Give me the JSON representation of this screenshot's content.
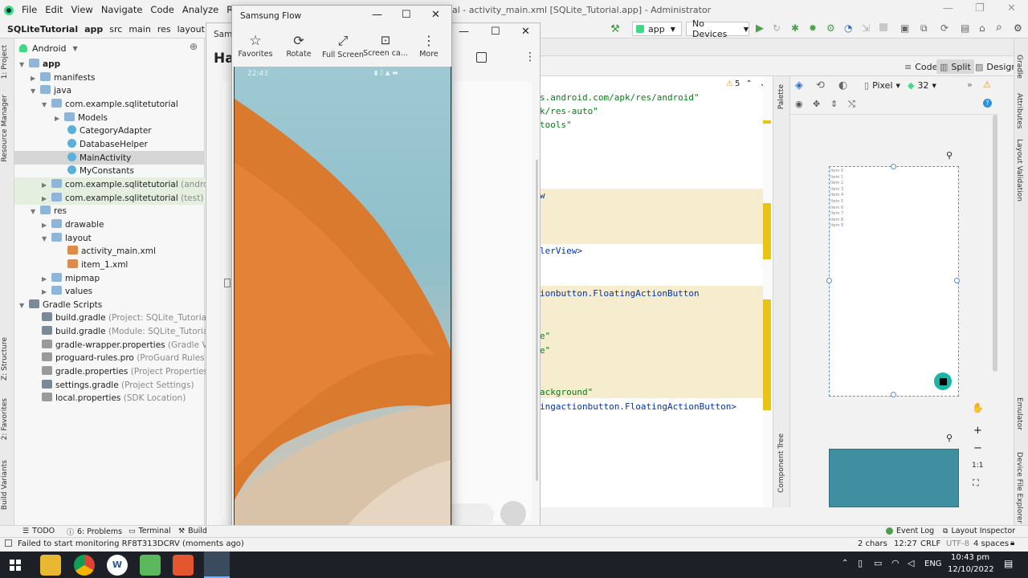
{
  "menu": {
    "items": [
      "File",
      "Edit",
      "View",
      "Navigate",
      "Code",
      "Analyze",
      "Refactor"
    ],
    "title_fragment": "al - activity_main.xml [SQLite_Tutorial.app] - Administrator"
  },
  "nav": {
    "crumbs": [
      "SQLiteTutorial",
      "app",
      "src",
      "main",
      "res",
      "layout"
    ],
    "run_config": "app",
    "device": "No Devices"
  },
  "left_tabs": {
    "project": "1: Project",
    "resource_manager": "Resource Manager",
    "structure": "Z: Structure",
    "favorites": "2: Favorites",
    "build_variants": "Build Variants"
  },
  "project_panel": {
    "view_mode": "Android",
    "tree": [
      {
        "label": "app",
        "bold": true
      },
      {
        "label": "manifests"
      },
      {
        "label": "java"
      },
      {
        "label": "com.example.sqlitetutorial"
      },
      {
        "label": "Models"
      },
      {
        "label": "CategoryAdapter"
      },
      {
        "label": "DatabaseHelper"
      },
      {
        "label": "MainActivity"
      },
      {
        "label": "MyConstants"
      },
      {
        "label": "com.example.sqlitetutorial",
        "suffix": "(androidTes"
      },
      {
        "label": "com.example.sqlitetutorial",
        "suffix": "(test)"
      },
      {
        "label": "res"
      },
      {
        "label": "drawable"
      },
      {
        "label": "layout"
      },
      {
        "label": "activity_main.xml"
      },
      {
        "label": "item_1.xml"
      },
      {
        "label": "mipmap"
      },
      {
        "label": "values"
      },
      {
        "label": "Gradle Scripts"
      },
      {
        "label": "build.gradle",
        "suffix": "(Project: SQLite_Tutorial)"
      },
      {
        "label": "build.gradle",
        "suffix": "(Module: SQLite_Tutorial.app)"
      },
      {
        "label": "gradle-wrapper.properties",
        "suffix": "(Gradle Version"
      },
      {
        "label": "proguard-rules.pro",
        "suffix": "(ProGuard Rules for SQ"
      },
      {
        "label": "gradle.properties",
        "suffix": "(Project Properties)"
      },
      {
        "label": "settings.gradle",
        "suffix": "(Project Settings)"
      },
      {
        "label": "local.properties",
        "suffix": "(SDK Location)"
      }
    ]
  },
  "editor": {
    "warning_count": "5",
    "lines": [
      "s.android.com/apk/res/android\"",
      "k/res-auto\"",
      "tools\"",
      "w",
      "lerView>",
      "ionbutton.FloatingActionButton",
      "e\"",
      "e\"",
      "ackground\"",
      "ingactionbutton.FloatingActionButton>"
    ]
  },
  "view_modes": {
    "code": "Code",
    "split": "Split",
    "design": "Design"
  },
  "design_toolbar": {
    "device": "Pixel",
    "api": "32"
  },
  "design_preview": {
    "items": [
      "Item 0",
      "Item 1",
      "Item 2",
      "Item 3",
      "Item 4",
      "Item 5",
      "Item 6",
      "Item 7",
      "Item 8",
      "Item 9"
    ],
    "zoom_ratio": "1:1"
  },
  "side_tabs": {
    "palette": "Palette",
    "component_tree": "Component Tree",
    "gradle": "Gradle",
    "attributes": "Attributes",
    "layout_validation": "Layout Validation",
    "emulator": "Emulator",
    "device_file_explorer": "Device File Explorer"
  },
  "samsung_back": {
    "title": "Sams",
    "heading": "Ha"
  },
  "samsung_flow": {
    "title": "Samsung Flow",
    "toolbar": [
      "Favorites",
      "Rotate",
      "Full Screen",
      "Screen ca...",
      "More"
    ],
    "phone_time": "22:43"
  },
  "bottom_tabs": [
    "TODO",
    "6: Problems",
    "Terminal",
    "Build"
  ],
  "bottom_right_tabs": [
    "Event Log",
    "Layout Inspector"
  ],
  "status": {
    "message": "Failed to start monitoring RF8T313DCRV (moments ago)",
    "chars": "2 chars",
    "position": "12:27",
    "line_sep": "CRLF",
    "encoding": "UTF-8",
    "indent": "4 spaces"
  },
  "taskbar": {
    "lang": "ENG",
    "time": "10:43 pm",
    "date": "12/10/2022"
  },
  "colors": {
    "ide_bg": "#f2f2f2",
    "accent_teal": "#3f8fa0",
    "fab": "#17b6a6",
    "highlight": "#f6ecce",
    "gutter_marker": "#e8c418"
  }
}
